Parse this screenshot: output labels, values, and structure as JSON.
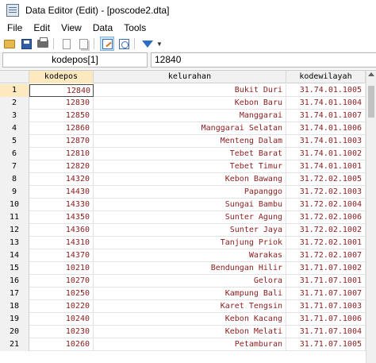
{
  "window": {
    "title": "Data Editor (Edit) - [poscode2.dta]"
  },
  "menu": [
    "File",
    "Edit",
    "View",
    "Data",
    "Tools"
  ],
  "toolbar": {
    "icons": [
      "open-icon",
      "save-icon",
      "print-icon",
      "copy-icon",
      "paste-icon",
      "edit-mode-icon",
      "browse-mode-icon",
      "filter-icon"
    ]
  },
  "varbar": {
    "name": "kodepos[1]",
    "value": "12840"
  },
  "columns": [
    "kodepos",
    "kelurahan",
    "kodewilayah"
  ],
  "rows": [
    {
      "n": "1",
      "kodepos": "12840",
      "kelurahan": "Bukit Duri",
      "kodewilayah": "31.74.01.1005"
    },
    {
      "n": "2",
      "kodepos": "12830",
      "kelurahan": "Kebon Baru",
      "kodewilayah": "31.74.01.1004"
    },
    {
      "n": "3",
      "kodepos": "12850",
      "kelurahan": "Manggarai",
      "kodewilayah": "31.74.01.1007"
    },
    {
      "n": "4",
      "kodepos": "12860",
      "kelurahan": "Manggarai Selatan",
      "kodewilayah": "31.74.01.1006"
    },
    {
      "n": "5",
      "kodepos": "12870",
      "kelurahan": "Menteng Dalam",
      "kodewilayah": "31.74.01.1003"
    },
    {
      "n": "6",
      "kodepos": "12810",
      "kelurahan": "Tebet Barat",
      "kodewilayah": "31.74.01.1002"
    },
    {
      "n": "7",
      "kodepos": "12820",
      "kelurahan": "Tebet Timur",
      "kodewilayah": "31.74.01.1001"
    },
    {
      "n": "8",
      "kodepos": "14320",
      "kelurahan": "Kebon Bawang",
      "kodewilayah": "31.72.02.1005"
    },
    {
      "n": "9",
      "kodepos": "14430",
      "kelurahan": "Papanggo",
      "kodewilayah": "31.72.02.1003"
    },
    {
      "n": "10",
      "kodepos": "14330",
      "kelurahan": "Sungai Bambu",
      "kodewilayah": "31.72.02.1004"
    },
    {
      "n": "11",
      "kodepos": "14350",
      "kelurahan": "Sunter Agung",
      "kodewilayah": "31.72.02.1006"
    },
    {
      "n": "12",
      "kodepos": "14360",
      "kelurahan": "Sunter Jaya",
      "kodewilayah": "31.72.02.1002"
    },
    {
      "n": "13",
      "kodepos": "14310",
      "kelurahan": "Tanjung Priok",
      "kodewilayah": "31.72.02.1001"
    },
    {
      "n": "14",
      "kodepos": "14370",
      "kelurahan": "Warakas",
      "kodewilayah": "31.72.02.1007"
    },
    {
      "n": "15",
      "kodepos": "10210",
      "kelurahan": "Bendungan Hilir",
      "kodewilayah": "31.71.07.1002"
    },
    {
      "n": "16",
      "kodepos": "10270",
      "kelurahan": "Gelora",
      "kodewilayah": "31.71.07.1001"
    },
    {
      "n": "17",
      "kodepos": "10250",
      "kelurahan": "Kampung Bali",
      "kodewilayah": "31.71.07.1007"
    },
    {
      "n": "18",
      "kodepos": "10220",
      "kelurahan": "Karet Tengsin",
      "kodewilayah": "31.71.07.1003"
    },
    {
      "n": "19",
      "kodepos": "10240",
      "kelurahan": "Kebon Kacang",
      "kodewilayah": "31.71.07.1006"
    },
    {
      "n": "20",
      "kodepos": "10230",
      "kelurahan": "Kebon Melati",
      "kodewilayah": "31.71.07.1004"
    },
    {
      "n": "21",
      "kodepos": "10260",
      "kelurahan": "Petamburan",
      "kodewilayah": "31.71.07.1005"
    }
  ]
}
